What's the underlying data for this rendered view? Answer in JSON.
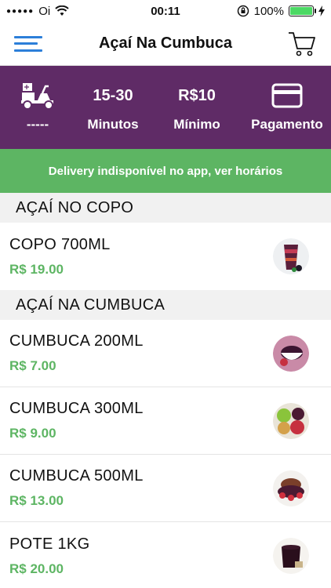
{
  "status_bar": {
    "carrier": "Oi",
    "time": "00:11",
    "battery": "100%"
  },
  "nav": {
    "title": "Açaí Na Cumbuca"
  },
  "info": {
    "delivery_value": "-----",
    "time_range": "15-30",
    "time_label": "Minutos",
    "minimum_value": "R$10",
    "minimum_label": "Mínimo",
    "payment_label": "Pagamento"
  },
  "notice": {
    "text": "Delivery indisponível no app, ver horários"
  },
  "sections": [
    {
      "title": "AÇAÍ NO COPO",
      "items": [
        {
          "name": "COPO 700ML",
          "price": "R$ 19.00"
        }
      ]
    },
    {
      "title": "AÇAÍ NA CUMBUCA",
      "items": [
        {
          "name": "CUMBUCA 200ML",
          "price": "R$ 7.00"
        },
        {
          "name": "CUMBUCA 300ML",
          "price": "R$ 9.00"
        },
        {
          "name": "CUMBUCA 500ML",
          "price": "R$ 13.00"
        },
        {
          "name": "POTE 1KG",
          "price": "R$ 20.00"
        }
      ]
    }
  ],
  "colors": {
    "primary_purple": "#5f2b66",
    "accent_green": "#5db563",
    "menu_blue": "#2c7fd9"
  }
}
